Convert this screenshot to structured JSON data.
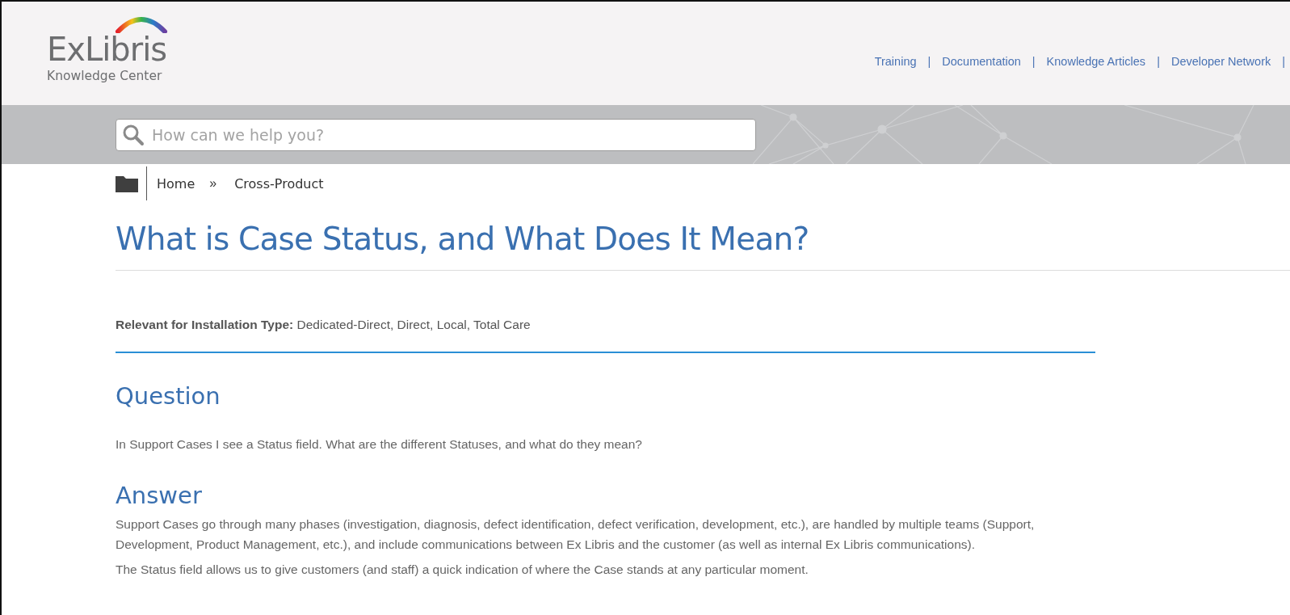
{
  "header": {
    "logo": {
      "name": "ExLibris",
      "subtitle": "Knowledge Center"
    },
    "nav_links": [
      {
        "label": "Training",
        "separator_after": "|"
      },
      {
        "label": "Documentation",
        "separator_after": "|"
      },
      {
        "label": "Knowledge Articles",
        "separator_after": "|"
      },
      {
        "label": "Developer Network",
        "separator_after": "|"
      }
    ]
  },
  "search": {
    "placeholder": "How can we help you?"
  },
  "breadcrumb": {
    "items": [
      "Home",
      "Cross-Product"
    ],
    "separator": "»"
  },
  "article": {
    "title": "What is Case Status, and What Does It Mean?",
    "relevant": "**Relevant for Installation Type:** Dedicated-Direct, Direct, Local, Total Care",
    "sections": [
      {
        "heading": "Question",
        "paragraphs": [
          "In Support Cases I see a Status field. What are the different Statuses, and what do they mean?"
        ]
      },
      {
        "heading": "Answer",
        "paragraphs": [
          "Support Cases go through many phases (investigation, diagnosis, defect identification, defect verification, development, etc.), are handled by multiple teams (Support, Development, Product Management, etc.), and include communications between Ex Libris and the customer (as well as internal Ex Libris communications).",
          "The Status field allows us to give customers (and staff) a quick indication of where the Case stands at any particular moment."
        ]
      }
    ]
  }
}
